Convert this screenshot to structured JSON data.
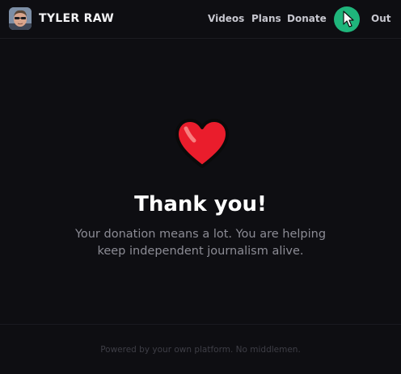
{
  "header": {
    "brand": "TYLER RAW",
    "nav": {
      "videos": "Videos",
      "plans": "Plans",
      "donate": "Donate",
      "out": "Out"
    },
    "accent_color": "#1fb57b"
  },
  "main": {
    "icon": "heart-icon",
    "title": "Thank you!",
    "message_line1": "Your donation means a lot. You are helping",
    "message_line2": "keep independent journalism alive."
  },
  "footer": {
    "text": "Powered by your own platform. No middlemen."
  }
}
